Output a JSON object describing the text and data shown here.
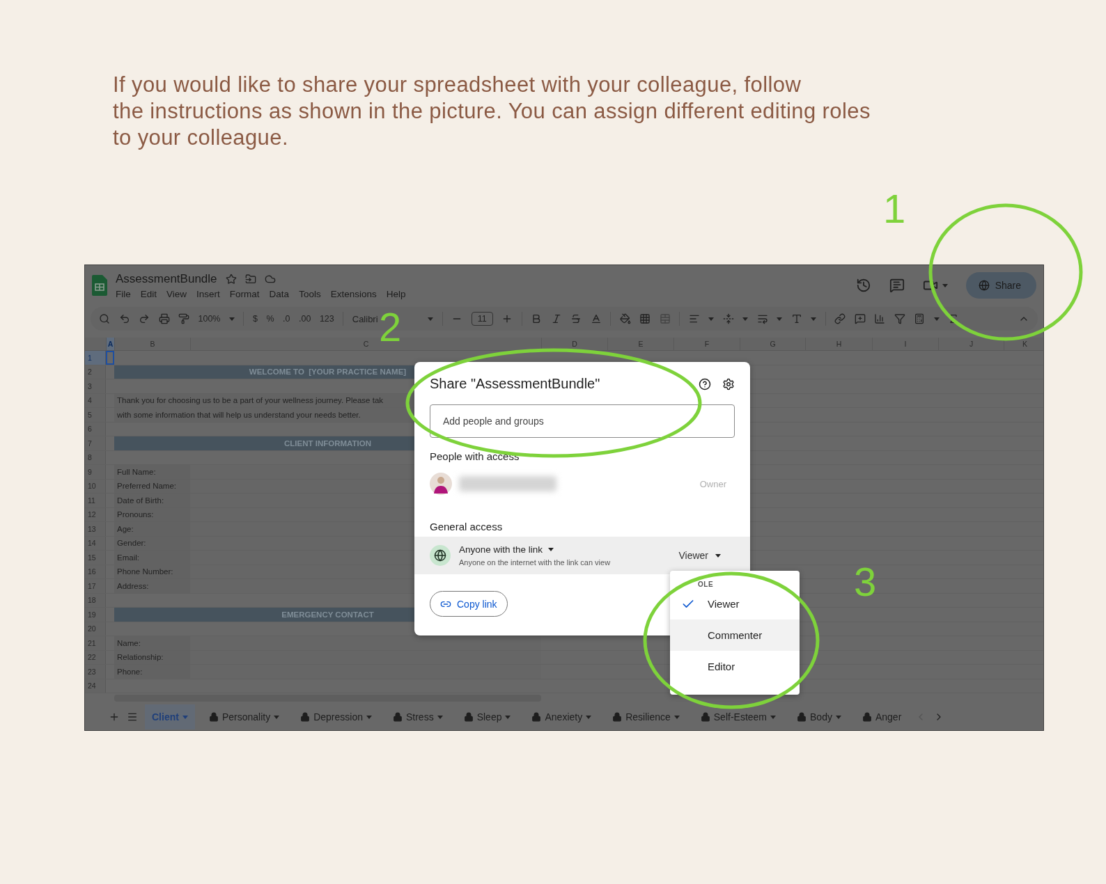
{
  "instructions": [
    "If you would like to share your spreadsheet with your colleague, follow",
    "the instructions as shown in the picture. You can assign different editing roles",
    "to your colleague."
  ],
  "annotations": [
    {
      "label": "1"
    },
    {
      "label": "2"
    },
    {
      "label": "3"
    }
  ],
  "app": {
    "title": "AssessmentBundle",
    "menu": [
      "File",
      "Edit",
      "View",
      "Insert",
      "Format",
      "Data",
      "Tools",
      "Extensions",
      "Help"
    ],
    "share_button": "Share",
    "toolbar": {
      "zoom": "100%",
      "currency": "$",
      "percent": "%",
      "decrease_decimals": ".0",
      "increase_decimals": ".00",
      "number_format": "123",
      "font": "Calibri",
      "font_size": "11"
    },
    "columns": [
      {
        "label": "A",
        "selected": true
      },
      {
        "label": "B",
        "selected": false
      },
      {
        "label": "C",
        "selected": false
      },
      {
        "label": "D",
        "selected": false
      },
      {
        "label": "E",
        "selected": false
      },
      {
        "label": "F",
        "selected": false
      },
      {
        "label": "G",
        "selected": false
      },
      {
        "label": "H",
        "selected": false
      },
      {
        "label": "I",
        "selected": false
      },
      {
        "label": "J",
        "selected": false
      },
      {
        "label": "K",
        "selected": false
      }
    ],
    "rows": [
      {
        "number": "1",
        "selected": true,
        "kind": "blank"
      },
      {
        "number": "2",
        "selected": false,
        "kind": "banner",
        "text": "WELCOME TO  [YOUR PRACTICE NAME]"
      },
      {
        "number": "3",
        "selected": false,
        "kind": "blank"
      },
      {
        "number": "4",
        "selected": false,
        "kind": "paragraph",
        "text": "Thank you for choosing us to be a part of your wellness journey. Please tak"
      },
      {
        "number": "5",
        "selected": false,
        "kind": "paragraph",
        "text": "with some information that will help us understand your needs better."
      },
      {
        "number": "6",
        "selected": false,
        "kind": "blank"
      },
      {
        "number": "7",
        "selected": false,
        "kind": "banner",
        "text": "CLIENT INFORMATION"
      },
      {
        "number": "8",
        "selected": false,
        "kind": "blank"
      },
      {
        "number": "9",
        "selected": false,
        "kind": "field",
        "text": "Full Name:"
      },
      {
        "number": "10",
        "selected": false,
        "kind": "field",
        "text": "Preferred Name:"
      },
      {
        "number": "11",
        "selected": false,
        "kind": "field",
        "text": "Date of Birth:"
      },
      {
        "number": "12",
        "selected": false,
        "kind": "field",
        "text": "Pronouns:"
      },
      {
        "number": "13",
        "selected": false,
        "kind": "field",
        "text": "Age:"
      },
      {
        "number": "14",
        "selected": false,
        "kind": "field",
        "text": "Gender:"
      },
      {
        "number": "15",
        "selected": false,
        "kind": "field",
        "text": "Email:"
      },
      {
        "number": "16",
        "selected": false,
        "kind": "field",
        "text": "Phone Number:"
      },
      {
        "number": "17",
        "selected": false,
        "kind": "field",
        "text": "Address:"
      },
      {
        "number": "18",
        "selected": false,
        "kind": "blank"
      },
      {
        "number": "19",
        "selected": false,
        "kind": "banner",
        "text": "EMERGENCY CONTACT"
      },
      {
        "number": "20",
        "selected": false,
        "kind": "blank"
      },
      {
        "number": "21",
        "selected": false,
        "kind": "field",
        "text": "Name:"
      },
      {
        "number": "22",
        "selected": false,
        "kind": "field",
        "text": "Relationship:"
      },
      {
        "number": "23",
        "selected": false,
        "kind": "field",
        "text": "Phone:"
      },
      {
        "number": "24",
        "selected": false,
        "kind": "blank"
      }
    ],
    "tabs": [
      {
        "label": "Client",
        "selected": true,
        "locked": false,
        "menu": true
      },
      {
        "label": "Personality",
        "selected": false,
        "locked": true,
        "menu": true
      },
      {
        "label": "Depression",
        "selected": false,
        "locked": true,
        "menu": true
      },
      {
        "label": "Stress",
        "selected": false,
        "locked": true,
        "menu": true
      },
      {
        "label": "Sleep",
        "selected": false,
        "locked": true,
        "menu": true
      },
      {
        "label": "Anexiety",
        "selected": false,
        "locked": true,
        "menu": true
      },
      {
        "label": "Resilience",
        "selected": false,
        "locked": true,
        "menu": true
      },
      {
        "label": "Self-Esteem",
        "selected": false,
        "locked": true,
        "menu": true
      },
      {
        "label": "Body",
        "selected": false,
        "locked": true,
        "menu": true
      },
      {
        "label": "Anger",
        "selected": false,
        "locked": true,
        "menu": false
      }
    ],
    "dialog": {
      "title": "Share \"AssessmentBundle\"",
      "placeholder": "Add people and groups",
      "people_heading": "People with access",
      "owner_role": "Owner",
      "general_heading": "General access",
      "access": "Anyone with the link",
      "access_description": "Anyone on the internet with the link can view",
      "role": "Viewer",
      "copy_link": "Copy link"
    },
    "role_menu": {
      "heading": "OLE",
      "items": [
        {
          "label": "Viewer",
          "selected": true,
          "hovered": false
        },
        {
          "label": "Commenter",
          "selected": false,
          "hovered": true
        },
        {
          "label": "Editor",
          "selected": false,
          "hovered": false
        }
      ]
    }
  }
}
